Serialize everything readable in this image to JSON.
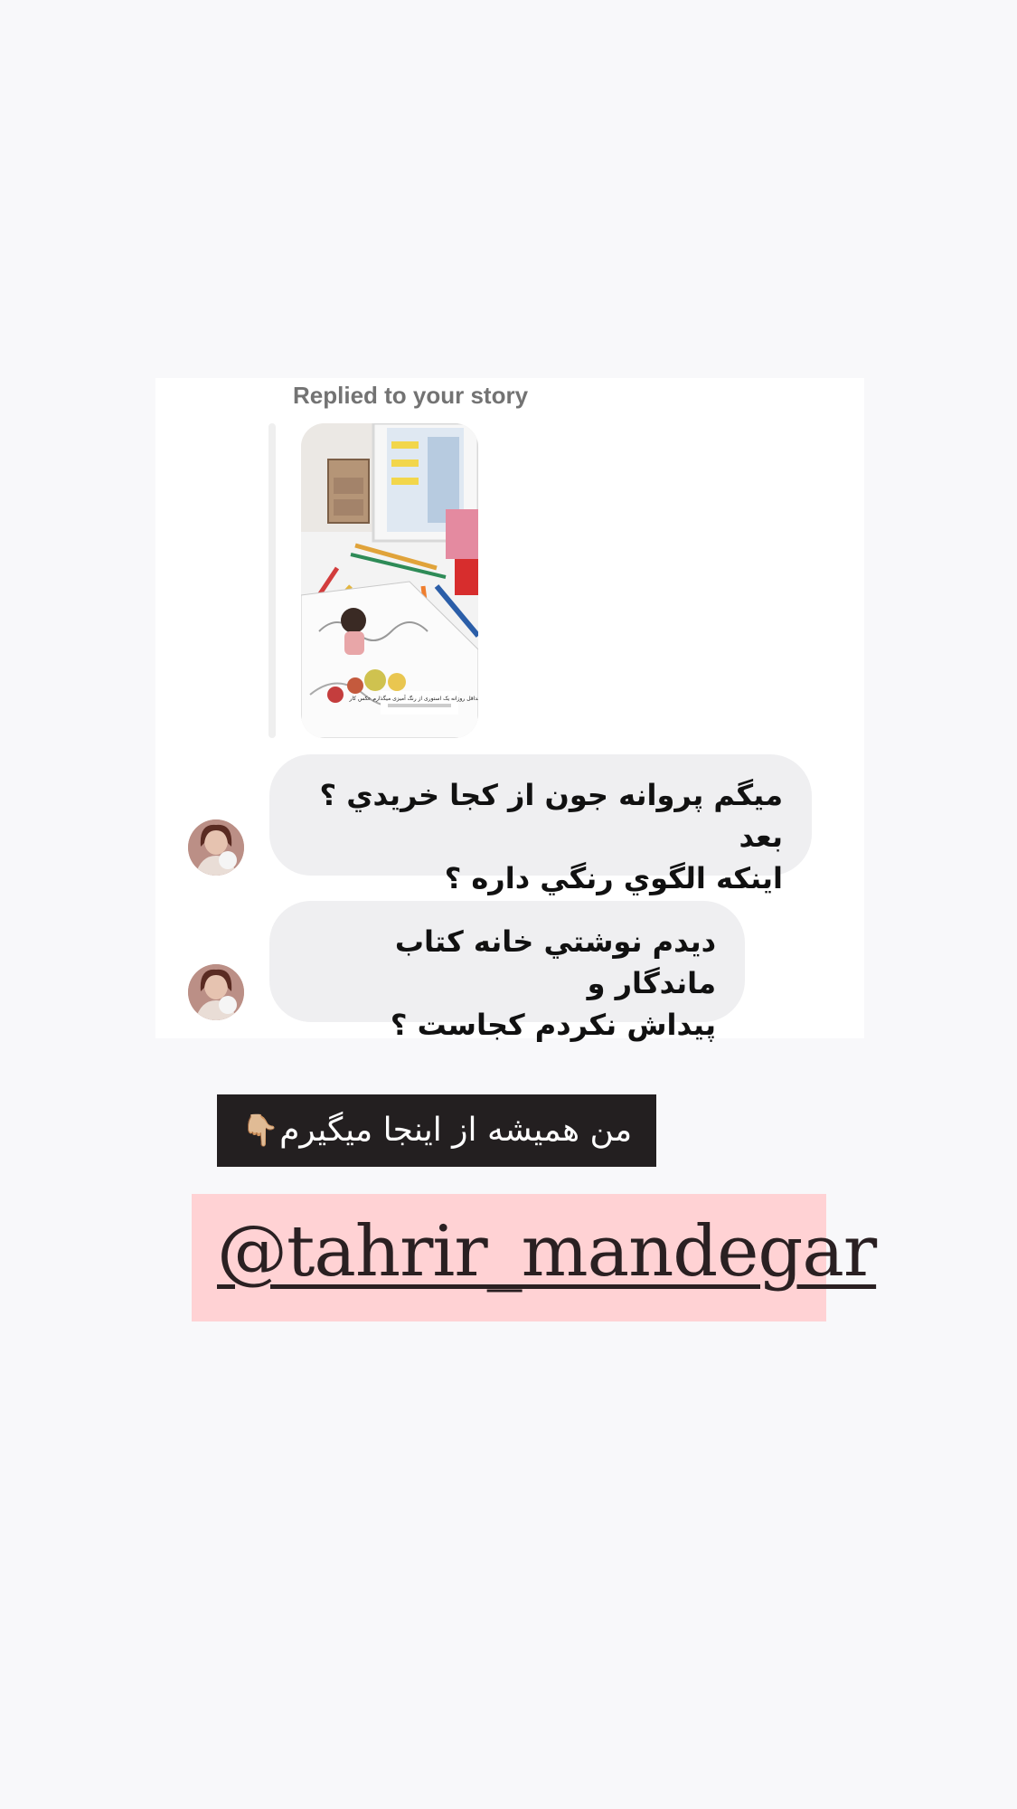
{
  "dm": {
    "replied_label": "Replied to your story",
    "story_caption": "حداقل روزانه یک استوری از رنگ آمیزی میگذارم عکس کار ❤️",
    "messages": [
      {
        "lines": [
          "ميگم پروانه جون از كجا خريدي ؟ بعد",
          "اينكه الگوي رنگي داره ؟"
        ]
      },
      {
        "lines": [
          "ديدم نوشتي خانه كتاب ماندگار و",
          "پيداش نكردم كجاست ؟"
        ]
      }
    ]
  },
  "overlay": {
    "caption": "من همیشه از اینجا میگیرم",
    "caption_icon": "👇🏼",
    "mention": "@tahrir_mandegar"
  },
  "colors": {
    "background": "#f8f8fa",
    "bubble": "#efeff1",
    "caption_bg": "#231f20",
    "mention_bg": "#ffd2d4"
  }
}
